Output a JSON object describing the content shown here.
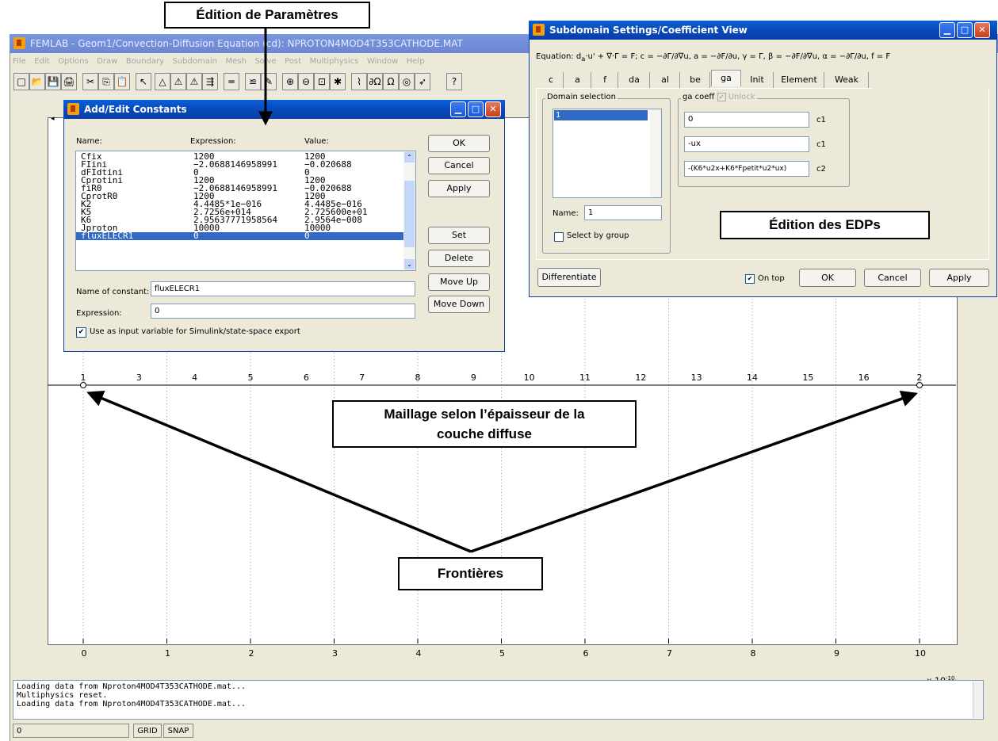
{
  "main_window": {
    "title": "FEMLAB - Geom1/Convection-Diffusion Equation (cd): NPROTON4MOD4T353CATHODE.MAT",
    "menu": [
      "File",
      "Edit",
      "Options",
      "Draw",
      "Boundary",
      "Subdomain",
      "Mesh",
      "Solve",
      "Post",
      "Multiphysics",
      "Window",
      "Help"
    ],
    "toolbar_glyphs": [
      "□",
      "📂",
      "💾",
      "🖨",
      "✂",
      "⎘",
      "📋",
      "↖",
      "△",
      "⚠",
      "⚠",
      "⇶",
      "═",
      "≌",
      "✎",
      "⊕",
      "⊖",
      "⊡",
      "✱",
      "⌇",
      "∂Ω",
      "Ω",
      "◎",
      "➶",
      "?"
    ],
    "console_lines": [
      "Loading data from Nproton4MOD4T353CATHODE.mat...",
      "Multiphysics reset.",
      "Loading data from Nproton4MOD4T353CATHODE.mat..."
    ],
    "status": {
      "field": "0",
      "grid": "GRID",
      "snap": "SNAP"
    }
  },
  "plot": {
    "x_ticks": [
      "0",
      "1",
      "2",
      "3",
      "4",
      "5",
      "6",
      "7",
      "8",
      "9",
      "10"
    ],
    "x_multiplier": "x 10",
    "x_exponent": "-10",
    "node_labels": [
      "1",
      "3",
      "4",
      "5",
      "6",
      "7",
      "8",
      "9",
      "10",
      "11",
      "12",
      "13",
      "14",
      "15",
      "16",
      "2"
    ]
  },
  "constants_dialog": {
    "title": "Add/Edit Constants",
    "col_name": "Name:",
    "col_expression": "Expression:",
    "col_value": "Value:",
    "rows": [
      {
        "name": "Cfix",
        "expr": "1200",
        "value": "1200"
      },
      {
        "name": "FIini",
        "expr": "−2.0688146958991",
        "value": "−0.020688"
      },
      {
        "name": "dFIdtini",
        "expr": "0",
        "value": "0"
      },
      {
        "name": "Cprotini",
        "expr": "1200",
        "value": "1200"
      },
      {
        "name": "fiR0",
        "expr": "−2.0688146958991",
        "value": "−0.020688"
      },
      {
        "name": "CprotR0",
        "expr": "1200",
        "value": "1200"
      },
      {
        "name": "K2",
        "expr": "4.4485*1e−016",
        "value": "4.4485e−016"
      },
      {
        "name": "K5",
        "expr": "2.7256e+014",
        "value": "2.725600e+01"
      },
      {
        "name": "K6",
        "expr": "2.95637771958564",
        "value": "2.9564e−008"
      },
      {
        "name": "Jproton",
        "expr": "10000",
        "value": "10000"
      },
      {
        "name": "fluxELECR1",
        "expr": "0",
        "value": "0"
      }
    ],
    "name_label": "Name of constant:",
    "name_value": "fluxELECR1",
    "expr_label": "Expression:",
    "expr_value": "0",
    "checkbox_label": "Use as input variable for Simulink/state-space export",
    "buttons": {
      "ok": "OK",
      "cancel": "Cancel",
      "apply": "Apply",
      "set": "Set",
      "delete": "Delete",
      "move_up": "Move Up",
      "move_down": "Move Down"
    }
  },
  "subdomain_dialog": {
    "title": "Subdomain Settings/Coefficient View",
    "equation": "Equation: d",
    "equation_sub": "a",
    "equation_rest": "·u' + ∇·Γ = F; c = −∂Γ/∂∇u, a = −∂F/∂u, γ = Γ, β = −∂F/∂∇u, α = −∂Γ/∂u, f = F",
    "tabs": [
      "c",
      "a",
      "f",
      "da",
      "al",
      "be",
      "ga",
      "Init",
      "Element",
      "Weak"
    ],
    "domain_group": "Domain selection",
    "domain_item": "1",
    "coeff_group": "ga coeff",
    "unlock": "Unlock",
    "coeffs": [
      {
        "value": "0",
        "label": "c1"
      },
      {
        "value": "-ux",
        "label": "c1"
      },
      {
        "value": "-(K6*u2x+K6*Fpetit*u2*ux)",
        "label": "c2"
      }
    ],
    "name_label": "Name:",
    "name_value": "1",
    "select_by_group": "Select by group",
    "differentiate": "Differentiate",
    "on_top": "On top",
    "ok": "OK",
    "cancel": "Cancel",
    "apply": "Apply"
  },
  "callouts": {
    "parametres": "Édition de Paramètres",
    "edps": "Édition des EDPs",
    "maillage_1": "Maillage selon l’épaisseur de la",
    "maillage_2": "couche diffuse",
    "frontieres": "Frontières"
  }
}
